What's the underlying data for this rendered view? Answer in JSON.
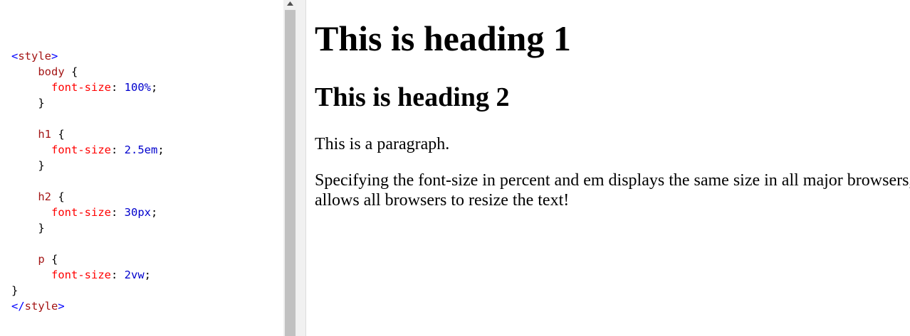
{
  "editor": {
    "lines": [
      [
        {
          "t": "<",
          "c": "tag-bracket"
        },
        {
          "t": "style",
          "c": "tag-name"
        },
        {
          "t": ">",
          "c": "tag-bracket"
        }
      ],
      [
        {
          "t": "    "
        },
        {
          "t": "body",
          "c": "sel"
        },
        {
          "t": " {",
          "c": "punct"
        }
      ],
      [
        {
          "t": "      "
        },
        {
          "t": "font-size",
          "c": "prop"
        },
        {
          "t": ": ",
          "c": "punct"
        },
        {
          "t": "100%",
          "c": "val"
        },
        {
          "t": ";",
          "c": "punct"
        }
      ],
      [
        {
          "t": "    "
        },
        {
          "t": "}",
          "c": "punct"
        }
      ],
      [
        {
          "t": ""
        }
      ],
      [
        {
          "t": "    "
        },
        {
          "t": "h1",
          "c": "sel"
        },
        {
          "t": " {",
          "c": "punct"
        }
      ],
      [
        {
          "t": "      "
        },
        {
          "t": "font-size",
          "c": "prop"
        },
        {
          "t": ": ",
          "c": "punct"
        },
        {
          "t": "2.5em",
          "c": "val"
        },
        {
          "t": ";",
          "c": "punct"
        }
      ],
      [
        {
          "t": "    "
        },
        {
          "t": "}",
          "c": "punct"
        }
      ],
      [
        {
          "t": ""
        }
      ],
      [
        {
          "t": "    "
        },
        {
          "t": "h2",
          "c": "sel"
        },
        {
          "t": " {",
          "c": "punct"
        }
      ],
      [
        {
          "t": "      "
        },
        {
          "t": "font-size",
          "c": "prop"
        },
        {
          "t": ": ",
          "c": "punct"
        },
        {
          "t": "30px",
          "c": "val"
        },
        {
          "t": ";",
          "c": "punct"
        }
      ],
      [
        {
          "t": "    "
        },
        {
          "t": "}",
          "c": "punct"
        }
      ],
      [
        {
          "t": ""
        }
      ],
      [
        {
          "t": "    "
        },
        {
          "t": "p",
          "c": "sel"
        },
        {
          "t": " {",
          "c": "punct"
        }
      ],
      [
        {
          "t": "      "
        },
        {
          "t": "font-size",
          "c": "prop"
        },
        {
          "t": ": ",
          "c": "punct"
        },
        {
          "t": "2vw",
          "c": "val"
        },
        {
          "t": ";",
          "c": "punct"
        }
      ],
      [
        {
          "t": "}",
          "c": "punct"
        }
      ],
      [
        {
          "t": "</",
          "c": "tag-bracket"
        },
        {
          "t": "style",
          "c": "tag-name"
        },
        {
          "t": ">",
          "c": "tag-bracket"
        }
      ]
    ]
  },
  "icons": {
    "scroll_up": "triangle-up-icon"
  },
  "result": {
    "heading1": "This is heading 1",
    "heading2": "This is heading 2",
    "paragraph1": "This is a paragraph.",
    "paragraph2": "Specifying the font-size in percent and em displays the same size in all major browsers, and allows all browsers to resize the text!"
  },
  "colors": {
    "tag": "#a31515",
    "tag_bracket": "#0000ff",
    "property": "#ff0000",
    "value": "#0000cd",
    "scroll_thumb": "#c1c1c1"
  }
}
